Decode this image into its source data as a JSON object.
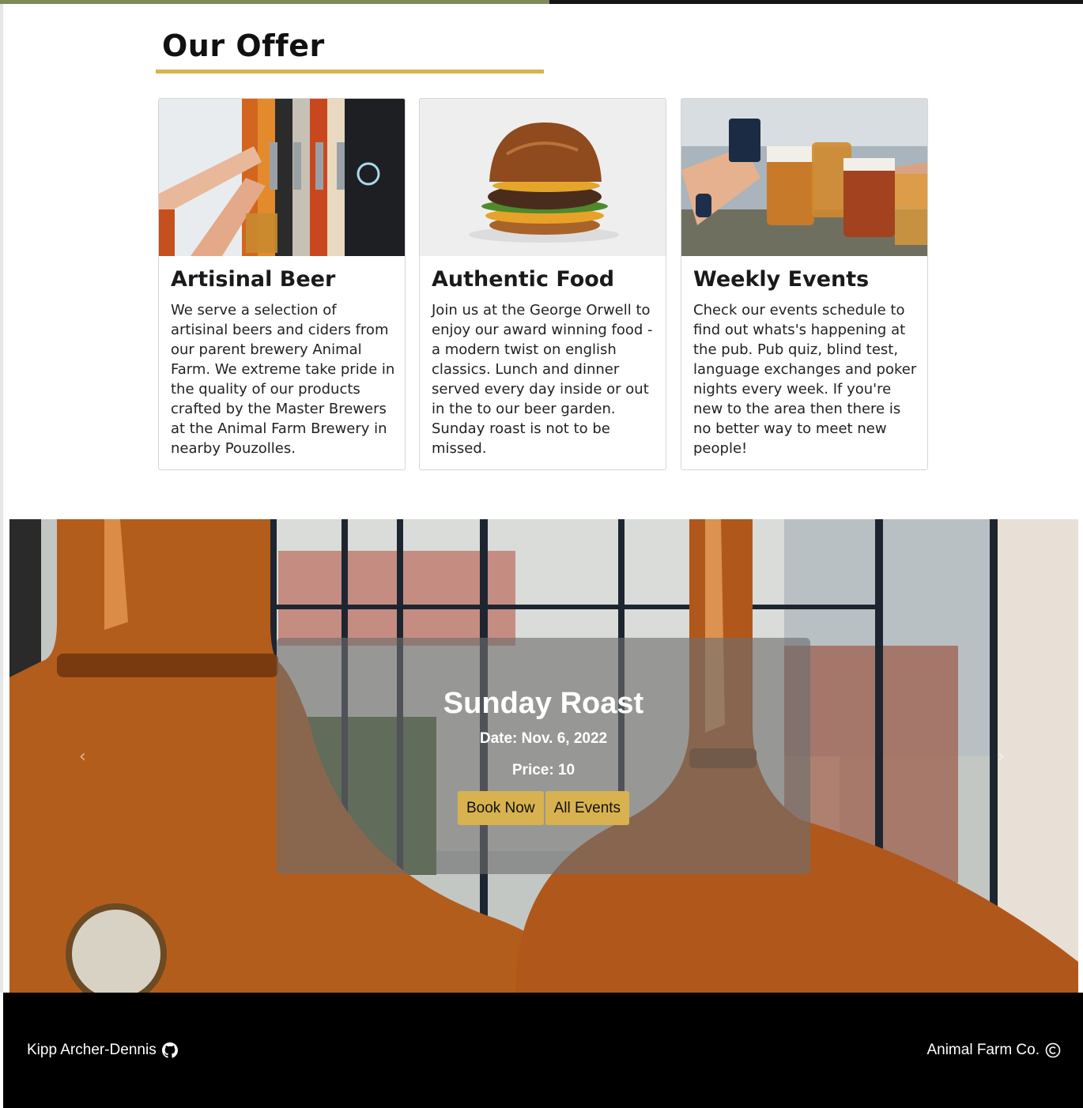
{
  "offer": {
    "title": "Our Offer",
    "cards": [
      {
        "title": "Artisinal Beer",
        "text": "We serve a selection of artisinal beers and ciders from our parent brewery Animal Farm. We extreme take pride in the quality of our products crafted by the Master Brewers at the Animal Farm Brewery in nearby Pouzolles."
      },
      {
        "title": "Authentic Food",
        "text": "Join us at the George Orwell to enjoy our award winning food - a modern twist on english classics. Lunch and dinner served every day inside or out in the to our beer garden. Sunday roast is not to be missed."
      },
      {
        "title": "Weekly Events",
        "text": "Check our events schedule to find out whats's happening at the pub. Pub quiz, blind test, language exchanges and poker nights every week. If you're new to the area then there is no better way to meet new people!"
      }
    ]
  },
  "event": {
    "title": "Sunday Roast",
    "date": "Date: Nov. 6, 2022",
    "price": "Price: 10",
    "book_label": "Book Now",
    "all_label": "All Events"
  },
  "footer": {
    "author": "Kipp Archer-Dennis",
    "company": "Animal Farm Co."
  },
  "colors": {
    "accent": "#d8b24f",
    "topbar_left": "#7e8a57",
    "footer_bg": "#000000"
  },
  "icons": [
    "github-icon",
    "copyright-icon",
    "carousel-prev-icon",
    "carousel-next-icon"
  ]
}
